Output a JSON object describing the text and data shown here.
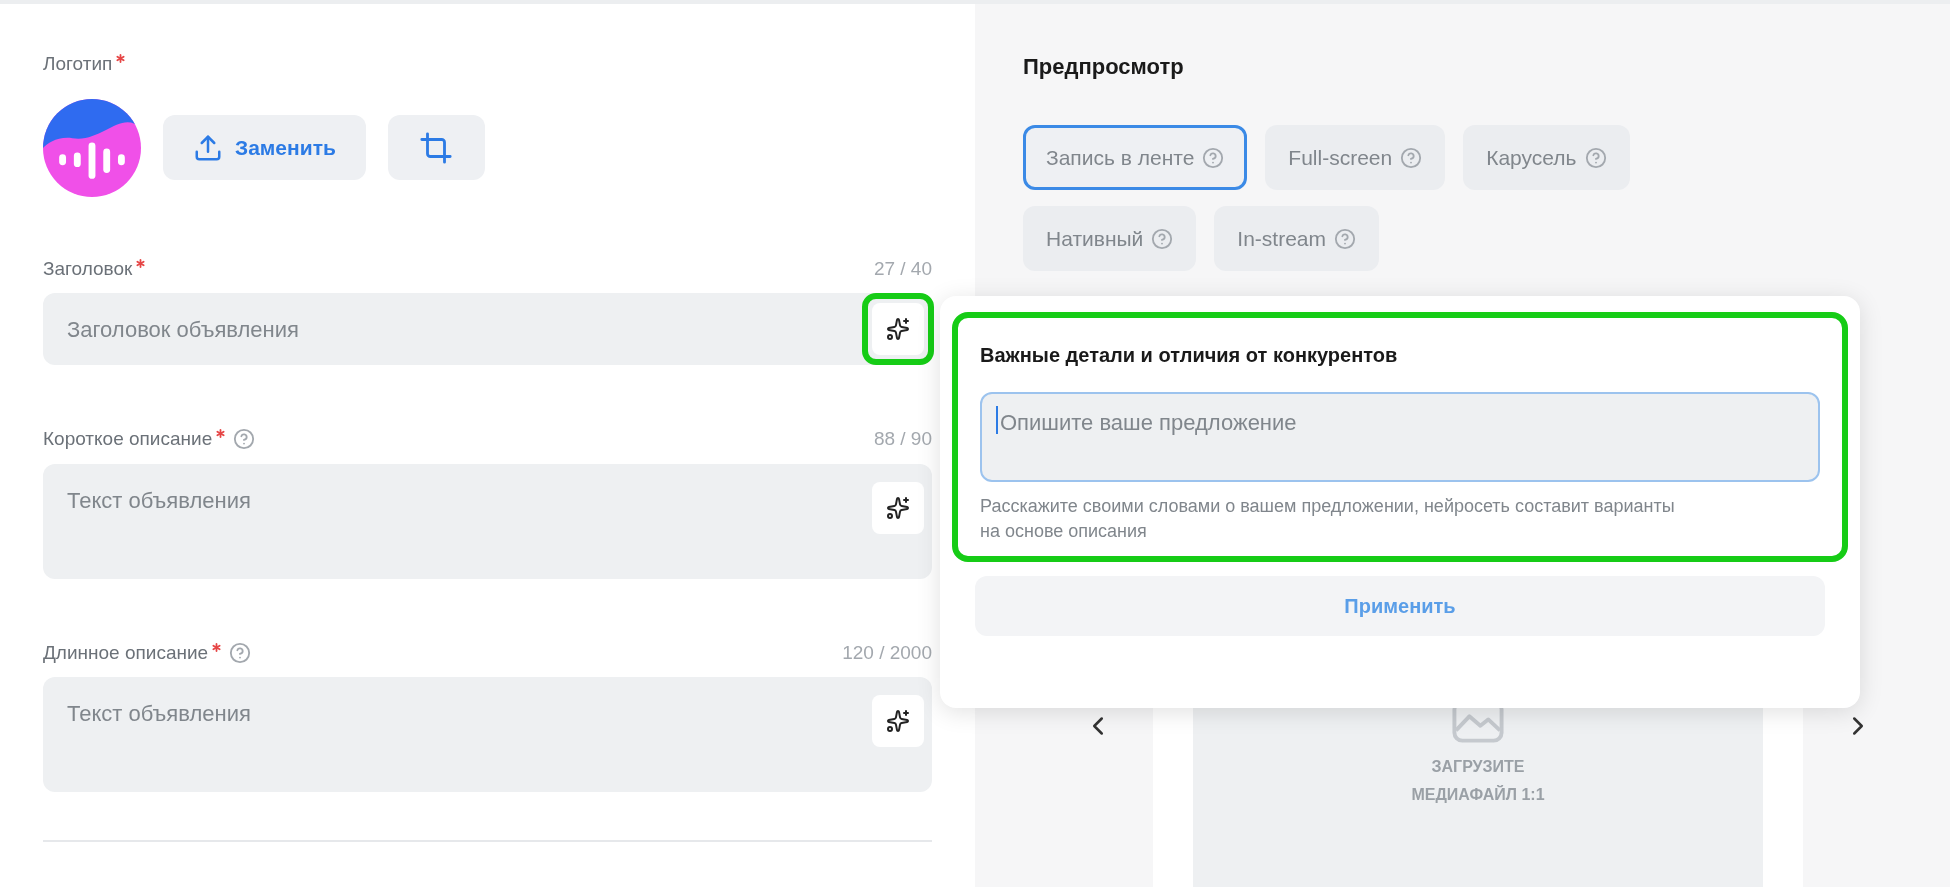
{
  "logo": {
    "label": "Логотип",
    "required": true,
    "replace_button": "Заменить"
  },
  "fields": [
    {
      "label": "Заголовок",
      "required": true,
      "help": false,
      "counter": "27 / 40",
      "placeholder": "Заголовок объявления",
      "multiline": false,
      "highlighted": true
    },
    {
      "label": "Короткое описание",
      "required": true,
      "help": true,
      "counter": "88 / 90",
      "placeholder": "Текст объявления",
      "multiline": true,
      "highlighted": false
    },
    {
      "label": "Длинное описание",
      "required": true,
      "help": true,
      "counter": "120 / 2000",
      "placeholder": "Текст объявления",
      "multiline": true,
      "highlighted": false
    }
  ],
  "preview": {
    "title": "Предпросмотр",
    "formats": [
      {
        "label": "Запись в ленте",
        "selected": true
      },
      {
        "label": "Full-screen",
        "selected": false
      },
      {
        "label": "Карусель",
        "selected": false
      },
      {
        "label": "Нативный",
        "selected": false
      },
      {
        "label": "In-stream",
        "selected": false
      }
    ],
    "media_placeholder": "ЗАГРУЗИТЕ МЕДИАФАЙЛ 1:1"
  },
  "ai_popup": {
    "title": "Важные детали и отличия от конкурентов",
    "placeholder": "Опишите ваше предложение",
    "hint": "Расскажите своими словами о вашем предложении, нейросеть составит варианты на основе описания",
    "apply_button": "Применить",
    "highlighted": true
  }
}
